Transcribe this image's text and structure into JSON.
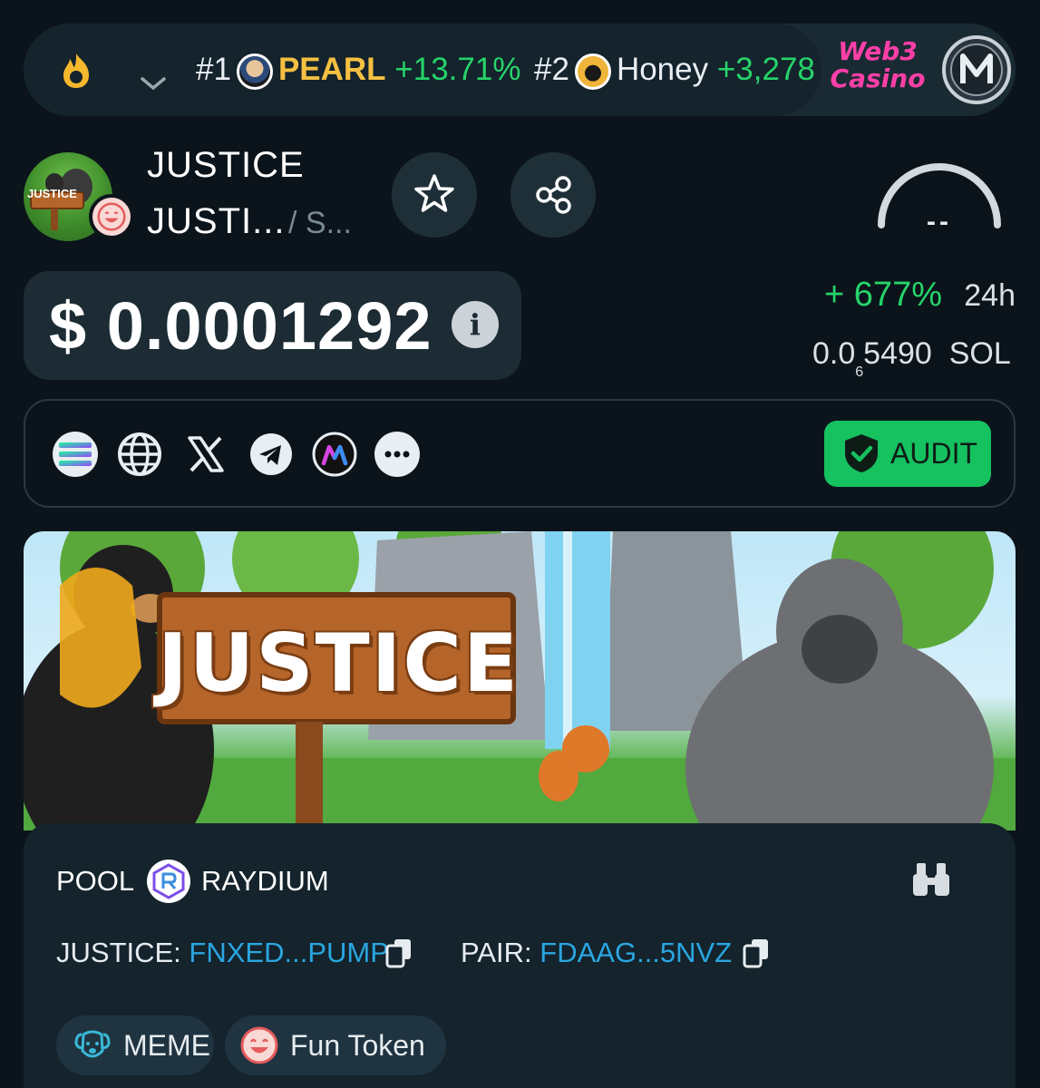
{
  "ticker": {
    "items": [
      {
        "rank": "#1",
        "name": "PEARL",
        "change": "+13.71%"
      },
      {
        "rank": "#2",
        "name": "Honey",
        "change": "+3,278"
      }
    ],
    "ad": {
      "line1": "Web3",
      "line2": "Casino"
    }
  },
  "token": {
    "symbol": "JUSTICE",
    "name": "JUSTI...",
    "chain": "/ S...",
    "avatar_label": "JUSTICE"
  },
  "gauge": {
    "value": "--"
  },
  "price": {
    "usd": "$ 0.0001292",
    "change_pct": "+ 677%",
    "change_period": "24h",
    "sol_prefix": "0.0",
    "sol_sub": "6",
    "sol_digits": "5490",
    "sol_unit": "SOL"
  },
  "links": {
    "icons": [
      "solana-icon",
      "globe-icon",
      "x-icon",
      "telegram-icon",
      "dextools-icon",
      "more-icon"
    ],
    "audit_label": "AUDIT"
  },
  "banner": {
    "title": "JUSTICE"
  },
  "pool": {
    "label": "POOL",
    "dex": "RAYDIUM",
    "token_label": "JUSTICE:",
    "token_address": "FNXED...PUMP",
    "pair_label": "PAIR:",
    "pair_address": "FDAAG...5NVZ"
  },
  "tags": [
    {
      "label": "MEME",
      "icon": "dog-icon"
    },
    {
      "label": "Fun Token",
      "icon": "smile-icon"
    }
  ],
  "colors": {
    "background": "#0b141b",
    "positive": "#26d46a",
    "link": "#2aa6e0",
    "audit": "#16c160",
    "pearl": "#f5c041"
  }
}
